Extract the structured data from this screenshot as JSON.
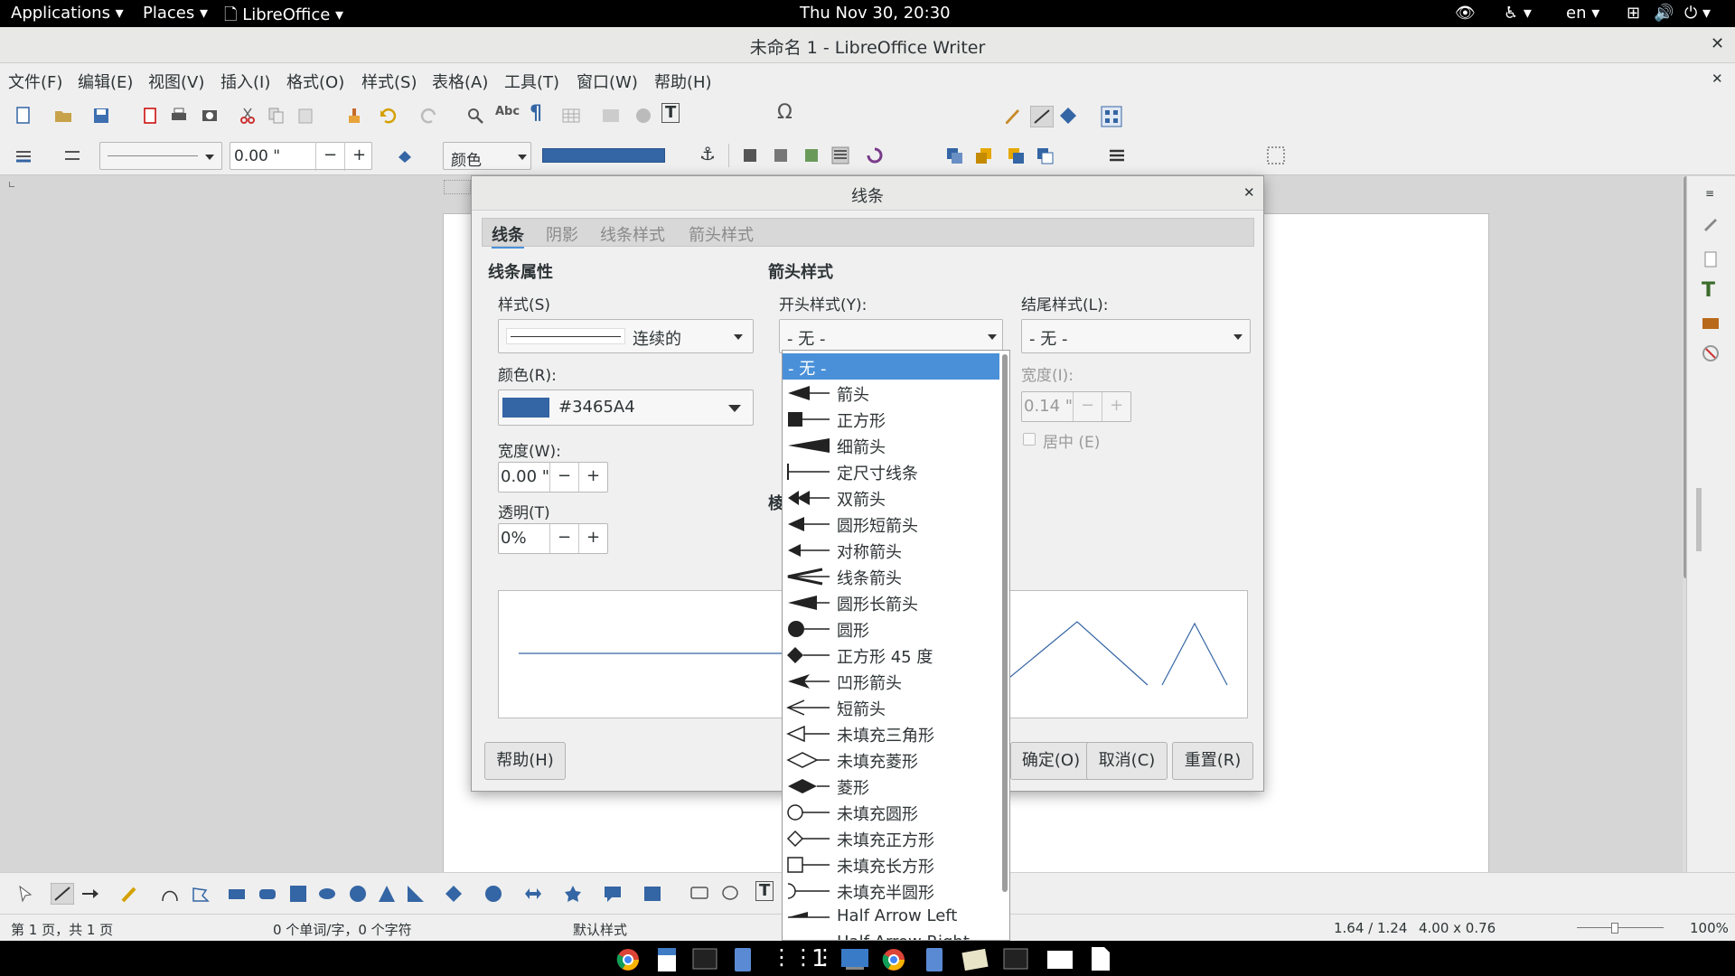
{
  "topbar": {
    "applications": "Applications",
    "places": "Places",
    "app": "LibreOffice",
    "clock": "Thu Nov 30, 20:30",
    "lang": "en"
  },
  "window": {
    "title": "未命名 1 - LibreOffice Writer"
  },
  "menu": [
    "文件(F)",
    "编辑(E)",
    "视图(V)",
    "插入(I)",
    "格式(O)",
    "样式(S)",
    "表格(A)",
    "工具(T)",
    "窗口(W)",
    "帮助(H)"
  ],
  "toolbar2": {
    "width_value": "0.00 \"",
    "color_label": "颜色"
  },
  "status": {
    "page": "第 1 页，共 1 页",
    "words": "0 个单词/字，0 个字符",
    "style": "默认样式",
    "position": "1.64 / 1.24",
    "size": "4.00 x 0.76",
    "zoom": "100%"
  },
  "dialog": {
    "title": "线条",
    "tabs": [
      "线条",
      "阴影",
      "线条样式",
      "箭头样式"
    ],
    "line_props": {
      "heading": "线条属性",
      "style_label": "样式(S)",
      "style_value": "连续的",
      "color_label": "颜色(R):",
      "color_value": "#3465A4",
      "color_swatch": "#3465A4",
      "width_label": "宽度(W):",
      "width_value": "0.00 \"",
      "transparency_label": "透明(T)",
      "transparency_value": "0%"
    },
    "arrow_styles": {
      "heading": "箭头样式",
      "start_label": "开头样式(Y):",
      "start_value": "- 无 -",
      "end_label": "结尾样式(L):",
      "end_value": "- 无 -",
      "end_width_label": "宽度(I):",
      "end_width_value": "0.14 \"",
      "center_label": "居中 (E)",
      "obscured_label": "棱"
    },
    "buttons": {
      "help": "帮助(H)",
      "ok": "确定(O)",
      "cancel": "取消(C)",
      "reset": "重置(R)"
    }
  },
  "dropdown": {
    "items": [
      {
        "label": "- 无 -",
        "icon": "none",
        "selected": true
      },
      {
        "label": "箭头",
        "icon": "arrow"
      },
      {
        "label": "正方形",
        "icon": "square"
      },
      {
        "label": "细箭头",
        "icon": "thin-arrow"
      },
      {
        "label": "定尺寸线条",
        "icon": "dimension-line"
      },
      {
        "label": "双箭头",
        "icon": "double-arrow"
      },
      {
        "label": "圆形短箭头",
        "icon": "round-short-arrow"
      },
      {
        "label": "对称箭头",
        "icon": "symmetric-arrow"
      },
      {
        "label": "线条箭头",
        "icon": "line-arrow"
      },
      {
        "label": "圆形长箭头",
        "icon": "round-long-arrow"
      },
      {
        "label": "圆形",
        "icon": "circle"
      },
      {
        "label": "正方形 45 度",
        "icon": "square-45"
      },
      {
        "label": "凹形箭头",
        "icon": "concave-arrow"
      },
      {
        "label": "短箭头",
        "icon": "short-arrow"
      },
      {
        "label": "未填充三角形",
        "icon": "unfilled-triangle"
      },
      {
        "label": "未填充菱形",
        "icon": "unfilled-diamond"
      },
      {
        "label": "菱形",
        "icon": "diamond"
      },
      {
        "label": "未填充圆形",
        "icon": "unfilled-circle"
      },
      {
        "label": "未填充正方形",
        "icon": "unfilled-square-45"
      },
      {
        "label": "未填充长方形",
        "icon": "unfilled-rectangle"
      },
      {
        "label": "未填充半圆形",
        "icon": "unfilled-half-circle"
      },
      {
        "label": "Half Arrow Left",
        "icon": "half-arrow-left"
      },
      {
        "label": "Half Arrow Right",
        "icon": "half-arrow-right"
      }
    ]
  },
  "colors": {
    "accent": "#4a90d9",
    "line_color": "#3465A4"
  }
}
